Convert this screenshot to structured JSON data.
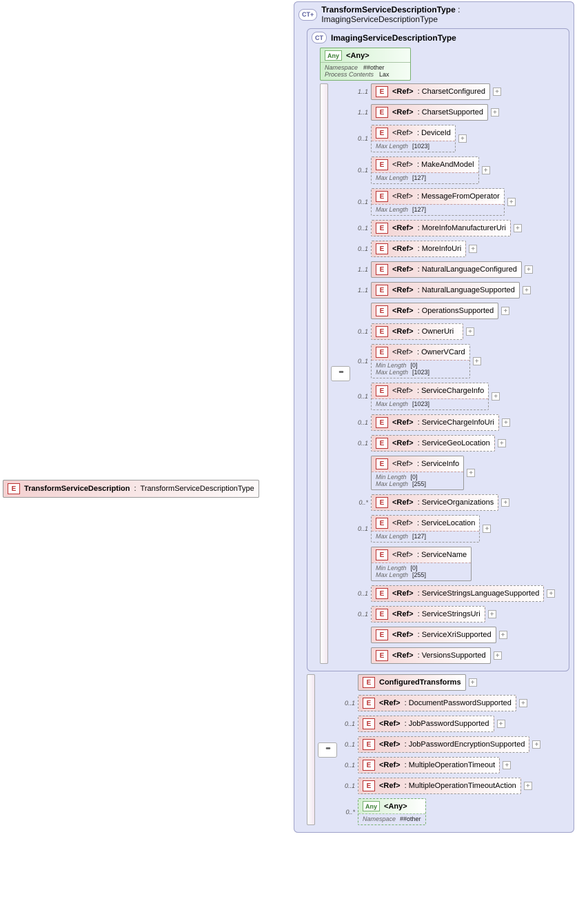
{
  "root": {
    "name": "TransformServiceDescription",
    "type": "TransformServiceDescriptionType"
  },
  "outer": {
    "badge": "CT+",
    "title": "TransformServiceDescriptionType",
    "sep": " : ",
    "base": "ImagingServiceDescriptionType"
  },
  "inner": {
    "badge": "CT",
    "title": "ImagingServiceDescriptionType"
  },
  "anyTop": {
    "badge": "Any",
    "label": "<Any>",
    "nsLabel": "Namespace",
    "nsVal": "##other",
    "pcLabel": "Process Contents",
    "pcVal": "Lax"
  },
  "tokens": {
    "E": "E",
    "Ref": "<Ref>",
    "Any": "Any",
    "sep": " : ",
    "maxLen": "Max Length",
    "minLen": "Min Length"
  },
  "innerRefs": [
    {
      "card": "1..1",
      "name": "CharsetConfigured",
      "dashed": false,
      "plus": true
    },
    {
      "card": "1..1",
      "name": "CharsetSupported",
      "dashed": false,
      "plus": true
    },
    {
      "card": "0..1",
      "name": "DeviceId",
      "dashed": true,
      "plus": true,
      "meta": {
        "maxLen": "[1023]"
      }
    },
    {
      "card": "0..1",
      "name": "MakeAndModel",
      "dashed": true,
      "plus": true,
      "meta": {
        "maxLen": "[127]"
      }
    },
    {
      "card": "0..1",
      "name": "MessageFromOperator",
      "dashed": true,
      "plus": true,
      "meta": {
        "maxLen": "[127]"
      }
    },
    {
      "card": "0..1",
      "name": "MoreInfoManufacturerUri",
      "dashed": true,
      "plus": true
    },
    {
      "card": "0..1",
      "name": "MoreInfoUri",
      "dashed": true,
      "plus": true
    },
    {
      "card": "1..1",
      "name": "NaturalLanguageConfigured",
      "dashed": false,
      "plus": true
    },
    {
      "card": "1..1",
      "name": "NaturalLanguageSupported",
      "dashed": false,
      "plus": true
    },
    {
      "card": "",
      "name": "OperationsSupported",
      "dashed": false,
      "plus": true,
      "pink": true,
      "noRefBadge": false
    },
    {
      "card": "0..1",
      "name": "OwnerUri",
      "dashed": true,
      "plus": true
    },
    {
      "card": "0..1",
      "name": "OwnerVCard",
      "dashed": true,
      "plus": true,
      "meta": {
        "minLen": "[0]",
        "maxLen": "[1023]"
      }
    },
    {
      "card": "0..1",
      "name": "ServiceChargeInfo",
      "dashed": true,
      "plus": true,
      "meta": {
        "maxLen": "[1023]"
      }
    },
    {
      "card": "0..1",
      "name": "ServiceChargeInfoUri",
      "dashed": true,
      "plus": true
    },
    {
      "card": "0..1",
      "name": "ServiceGeoLocation",
      "dashed": true,
      "plus": true
    },
    {
      "card": "",
      "name": "ServiceInfo",
      "dashed": false,
      "plus": true,
      "pink": true,
      "meta": {
        "minLen": "[0]",
        "maxLen": "[255]"
      }
    },
    {
      "card": "0..*",
      "name": "ServiceOrganizations",
      "dashed": true,
      "plus": true
    },
    {
      "card": "0..1",
      "name": "ServiceLocation",
      "dashed": true,
      "plus": true,
      "meta": {
        "maxLen": "[127]"
      }
    },
    {
      "card": "",
      "name": "ServiceName",
      "dashed": false,
      "plus": false,
      "pink": true,
      "meta": {
        "minLen": "[0]",
        "maxLen": "[255]"
      }
    },
    {
      "card": "0..1",
      "name": "ServiceStringsLanguageSupported",
      "dashed": true,
      "plus": true
    },
    {
      "card": "0..1",
      "name": "ServiceStringsUri",
      "dashed": true,
      "plus": true
    },
    {
      "card": "",
      "name": "ServiceXriSupported",
      "dashed": false,
      "plus": true,
      "pink": true
    },
    {
      "card": "",
      "name": "VersionsSupported",
      "dashed": false,
      "plus": true,
      "pink": true
    }
  ],
  "outerSeq": [
    {
      "kind": "element",
      "card": "",
      "name": "ConfiguredTransforms",
      "dashed": false,
      "plus": true
    },
    {
      "kind": "ref",
      "card": "0..1",
      "name": "DocumentPasswordSupported",
      "dashed": true,
      "plus": true
    },
    {
      "kind": "ref",
      "card": "0..1",
      "name": "JobPasswordSupported",
      "dashed": true,
      "plus": true
    },
    {
      "kind": "ref",
      "card": "0..1",
      "name": "JobPasswordEncryptionSupported",
      "dashed": true,
      "plus": true
    },
    {
      "kind": "ref",
      "card": "0..1",
      "name": "MultipleOperationTimeout",
      "dashed": true,
      "plus": true
    },
    {
      "kind": "ref",
      "card": "0..1",
      "name": "MultipleOperationTimeoutAction",
      "dashed": true,
      "plus": true
    },
    {
      "kind": "any",
      "card": "0..*",
      "label": "<Any>",
      "nsLabel": "Namespace",
      "nsVal": "##other"
    }
  ]
}
